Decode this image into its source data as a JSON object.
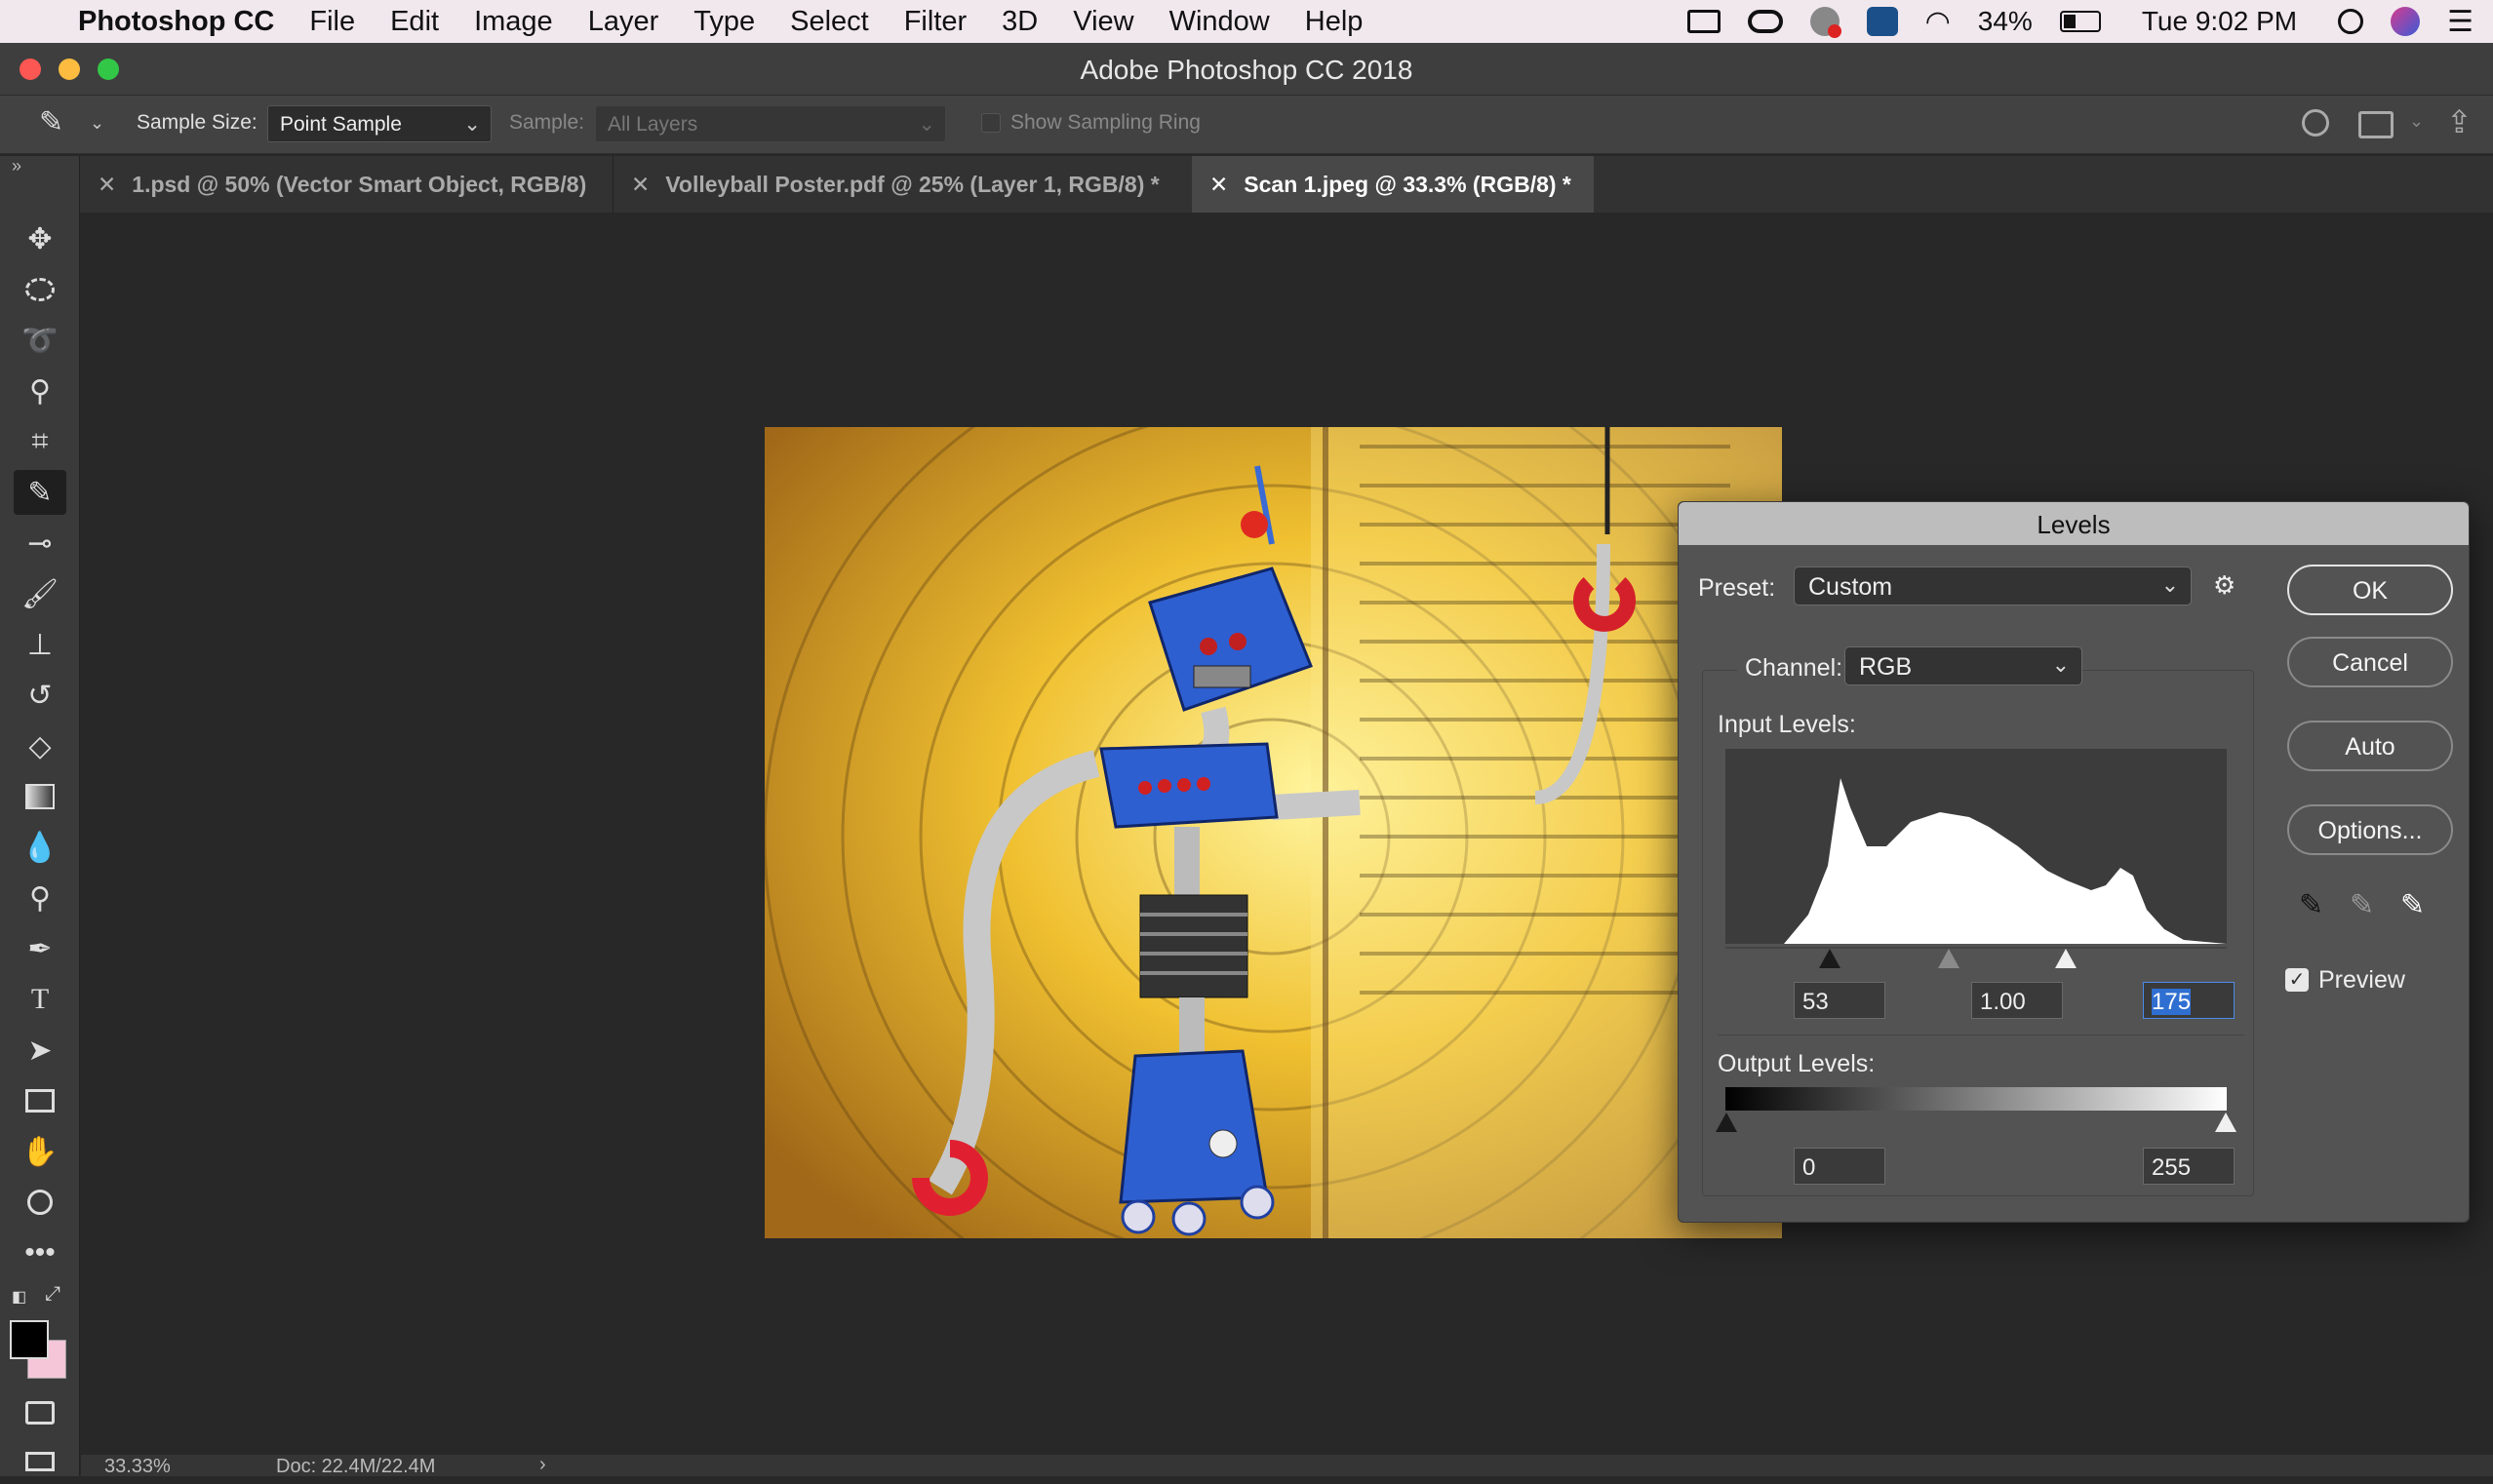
{
  "menubar": {
    "apple": "",
    "app_name": "Photoshop CC",
    "items": [
      "File",
      "Edit",
      "Image",
      "Layer",
      "Type",
      "Select",
      "Filter",
      "3D",
      "View",
      "Window",
      "Help"
    ],
    "battery": "34%",
    "clock": "Tue 9:02 PM"
  },
  "window": {
    "title": "Adobe Photoshop CC 2018"
  },
  "options": {
    "sample_size_label": "Sample Size:",
    "sample_size_value": "Point Sample",
    "sample_label": "Sample:",
    "sample_value": "All Layers",
    "sampling_ring_label": "Show Sampling Ring"
  },
  "tabs": [
    {
      "label": "1.psd @ 50% (Vector Smart Object, RGB/8)"
    },
    {
      "label": "Volleyball Poster.pdf @ 25% (Layer 1, RGB/8) *"
    },
    {
      "label": "Scan 1.jpeg @ 33.3% (RGB/8) *"
    }
  ],
  "levels": {
    "title": "Levels",
    "preset_label": "Preset:",
    "preset_value": "Custom",
    "channel_label": "Channel:",
    "channel_value": "RGB",
    "input_label": "Input Levels:",
    "input_black": "53",
    "input_gamma": "1.00",
    "input_white": "175",
    "output_label": "Output Levels:",
    "output_black": "0",
    "output_white": "255",
    "buttons": {
      "ok": "OK",
      "cancel": "Cancel",
      "auto": "Auto",
      "options": "Options..."
    },
    "preview_label": "Preview",
    "preview_checked": true
  },
  "status": {
    "zoom": "33.33%",
    "doc": "Doc: 22.4M/22.4M"
  },
  "colors": {
    "accent": "#2f6fd1",
    "foreground": "#000000",
    "background": "#f4c6d8"
  }
}
